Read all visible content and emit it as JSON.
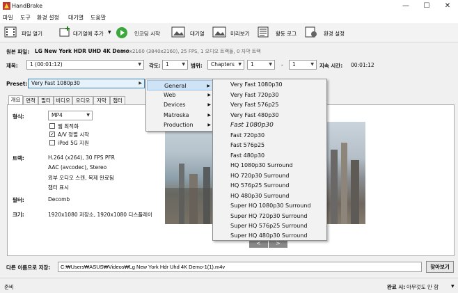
{
  "app": {
    "title": "HandBrake"
  },
  "window_controls": {
    "minimize": "—",
    "maximize": "☐",
    "close": "✕"
  },
  "menu": [
    "파일",
    "도구",
    "환경 설정",
    "대기열",
    "도움말"
  ],
  "toolbar": {
    "open_source": "파일 열기",
    "add_queue": "대기열에 추가",
    "start_encode": "인코딩 시작",
    "queue": "대기열",
    "preview": "미리보기",
    "activity_log": "활동 로그",
    "preferences": "환경 설정"
  },
  "source": {
    "label": "원본 파일:",
    "name": "LG New York HDR UHD 4K Demo",
    "info": "3840x2160 (3840x2160), 25 FPS, 1 오디오 트랙들, 0 자막 트랙"
  },
  "title_row": {
    "title_label": "제목:",
    "title_value": "1  (00:01:12)",
    "angle_label": "각도:",
    "angle_value": "1",
    "range_label": "범위:",
    "range_value": "Chapters",
    "range_start": "1",
    "range_sep": "-",
    "range_end": "1",
    "duration_label": "지속 시간:",
    "duration_value": "00:01:12"
  },
  "preset": {
    "label": "Preset:",
    "value": "Very Fast 1080p30"
  },
  "tabs": [
    "개요",
    "면적",
    "필터",
    "비디오",
    "오디오",
    "자막",
    "챕터"
  ],
  "summary": {
    "format_label": "형식:",
    "format_value": "MP4",
    "web_optimized": "웹 최적화",
    "av_align": "A/V 정렬 시작",
    "ipod": "iPod 5G 지원",
    "av_align_checked": "✓",
    "tracks_label": "트랙:",
    "tracks": [
      "H.264 (x264), 30 FPS PFR",
      "AAC (avcodec), Stereo",
      "외부 오디오 스캔, 복제 완료됨",
      "챕터 표시"
    ],
    "filters_label": "필터:",
    "filters_value": "Decomb",
    "size_label": "크기:",
    "size_value": "1920x1080 저장소, 1920x1080 디스플레이"
  },
  "preset_menu": {
    "categories": [
      "General",
      "Web",
      "Devices",
      "Matroska",
      "Production"
    ],
    "general_presets": [
      "Very Fast 1080p30",
      "Very Fast 720p30",
      "Very Fast 576p25",
      "Very Fast 480p30",
      "Fast 1080p30",
      "Fast 720p30",
      "Fast 576p25",
      "Fast 480p30",
      "HQ 1080p30 Surround",
      "HQ 720p30 Surround",
      "HQ 576p25 Surround",
      "HQ 480p30 Surround",
      "Super HQ 1080p30 Surround",
      "Super HQ 720p30 Surround",
      "Super HQ 576p25 Surround",
      "Super HQ 480p30 Surround"
    ],
    "default_preset": "Fast 1080p30"
  },
  "preview_nav": {
    "prev": "<",
    "next": ">"
  },
  "destination": {
    "label": "다른 이름으로 저장:",
    "path": "C:₩Users₩ASUS₩Videos₩Lg New York Hdr Uhd 4K Demo-1(1).m4v",
    "browse": "찾아보기"
  },
  "status": {
    "left": "준비",
    "when_done_label": "완료 시:",
    "when_done_value": "아무것도 안 함"
  }
}
